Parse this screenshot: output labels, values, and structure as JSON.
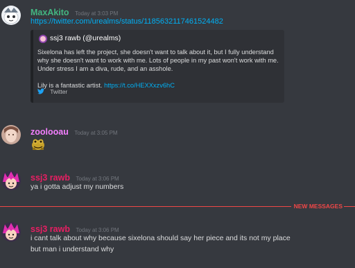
{
  "messages": [
    {
      "username": "MaxAkito",
      "username_color": "#43b581",
      "timestamp": "Today at 3:03 PM",
      "link": "https://twitter.com/urealms/status/1185632117461524482",
      "embed": {
        "author": "ssj3 rawb (@urealms)",
        "description_p1": "Sixelona has left the project, she doesn't want to talk about it, but I fully understand why she doesn't want to work with me. Lots of people in my past won't work with me. Under stress I am a diva, rude, and an asshole.",
        "description_p2_text": "Lily is a fantastic artist.",
        "description_p2_link": "https://t.co/HEXXxzv6hC",
        "footer": "Twitter"
      }
    },
    {
      "username": "zoolooau",
      "username_color": "#f47fff",
      "timestamp": "Today at 3:05 PM",
      "content": "🐸"
    },
    {
      "username": "ssj3 rawb",
      "username_color": "#e91e63",
      "timestamp": "Today at 3:06 PM",
      "content": "ya i gotta adjust my numbers"
    },
    {
      "username": "ssj3 rawb",
      "username_color": "#e91e63",
      "timestamp": "Today at 3:06 PM",
      "content_line1": "i cant talk about why because sixelona should say her piece and its not my place",
      "content_line2": "but man i understand why"
    }
  ],
  "new_messages_label": "NEW MESSAGES",
  "colors": {
    "background": "#36393f",
    "embed_bg": "#2f3136",
    "link": "#00b0f4",
    "divider": "#f04747",
    "timestamp": "#72767d"
  },
  "icons": [
    "maxakito-avatar",
    "zoolooau-avatar",
    "ssj3-rawb-avatar",
    "twitter-bird-icon",
    "custom-emoji"
  ]
}
